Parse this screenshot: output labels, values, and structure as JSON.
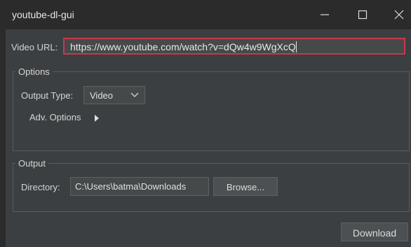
{
  "window": {
    "title": "youtube-dl-gui",
    "controls": [
      "minimize-icon",
      "maximize-icon",
      "close-icon"
    ]
  },
  "url": {
    "label": "Video URL:",
    "value": "https://www.youtube.com/watch?v=dQw4w9WgXcQ",
    "accent_color": "#c7394b"
  },
  "options": {
    "group_title": "Options",
    "output_type_label": "Output Type:",
    "output_type_value": "Video",
    "adv_options_label": "Adv. Options"
  },
  "output": {
    "group_title": "Output",
    "directory_label": "Directory:",
    "directory_value": "C:\\Users\\batma\\Downloads",
    "browse_label": "Browse..."
  },
  "actions": {
    "download_label": "Download"
  }
}
